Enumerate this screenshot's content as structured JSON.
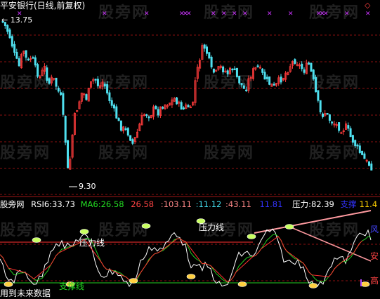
{
  "watermark": "股旁网",
  "top_panel": {
    "title": "平安银行(日线,前复权)",
    "high_label": "13.75",
    "low_label": "9.30",
    "signal_marks": "✕",
    "corner_icon": "diamond-icon"
  },
  "indicator_header": {
    "source": "股旁网",
    "rsi_label": "RSI6:",
    "rsi_value": "33.73",
    "ma_label": "MA6:",
    "ma_value": "26.58",
    "val3": "26.58",
    "val4": ":103.11",
    "val5": ":11.12",
    "val6": ":43.11",
    "val7": "11.81",
    "pressure_label": "压力:",
    "pressure_value": "82.39",
    "support_label": "支撑",
    "support_value": "11.4"
  },
  "annotations": {
    "pressure_line_1": "压力线",
    "pressure_line_2": "压力线",
    "support_line": "支撑线",
    "right_risk": "风",
    "right_safe": "安",
    "right_high": "高",
    "footer_hint": "用到未来数据"
  },
  "colors": {
    "up_candle": "#ff3b3b",
    "down_candle": "#4fe0ef",
    "grid": "#8b1010",
    "rsi_line": "#ffffff",
    "ma_line": "#22cc22",
    "pressure_trend": "#ff9aa0",
    "signal": "#cc33ff",
    "header_red": "#ff4444",
    "header_green": "#22dd22",
    "header_blue": "#4444ff"
  }
}
